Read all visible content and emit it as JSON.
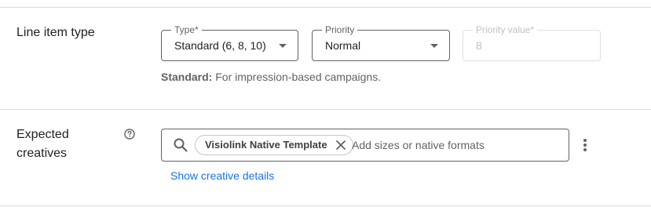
{
  "line_item_type": {
    "label": "Line item type",
    "type_field": {
      "label": "Type*",
      "value": "Standard (6, 8, 10)"
    },
    "priority_field": {
      "label": "Priority",
      "value": "Normal"
    },
    "priority_value_field": {
      "label": "Priority value*",
      "value": "8"
    },
    "hint_bold": "Standard:",
    "hint_text": " For impression-based campaigns."
  },
  "expected_creatives": {
    "label_line1": "Expected",
    "label_line2": "creatives",
    "help_icon": "help-circle-icon",
    "chip_label": "Visiolink Native Template",
    "input_placeholder": "Add sizes or native formats",
    "details_link": "Show creative details"
  },
  "colors": {
    "link": "#1a73e8",
    "border": "#5f6368",
    "divider": "#dadce0",
    "disabled": "#bdc1c6"
  }
}
